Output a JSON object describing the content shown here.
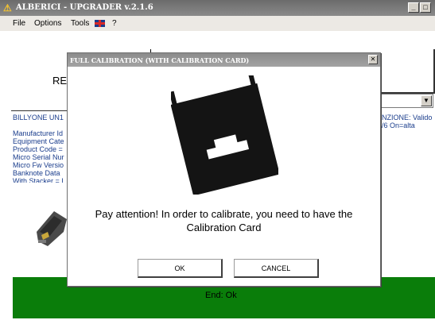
{
  "window": {
    "title": "ALBERICI - UPGRADER v.2.1.6",
    "icon": "warning-app-icon"
  },
  "menu": {
    "items": [
      "File",
      "Options",
      "Tools"
    ],
    "help": "?"
  },
  "main": {
    "re_label": "RE",
    "left_panel": {
      "device_title": "BILLYONE UN1",
      "lines": [
        "Manufacturer Id",
        "Equipment Cate",
        "Product Code =",
        "Micro Serial Nur",
        "Micro Fw Versio",
        "Banknote Data",
        "With Stacker = I"
      ]
    },
    "right_panel": {
      "line1": "NZIONE: Valido",
      "line2": "/6 On=alta"
    },
    "status": "End: Ok"
  },
  "dialog": {
    "title": "FULL CALIBRATION (WITH CALIBRATION CARD)",
    "message_line1": "Pay attention! In order to calibrate, you need to have the",
    "message_line2": "Calibration Card",
    "ok_label": "OK",
    "cancel_label": "CANCEL"
  },
  "colors": {
    "status_bg": "#0a7d0a",
    "titlebar": "#7a7a7a",
    "info_text": "#1a3d8c"
  }
}
